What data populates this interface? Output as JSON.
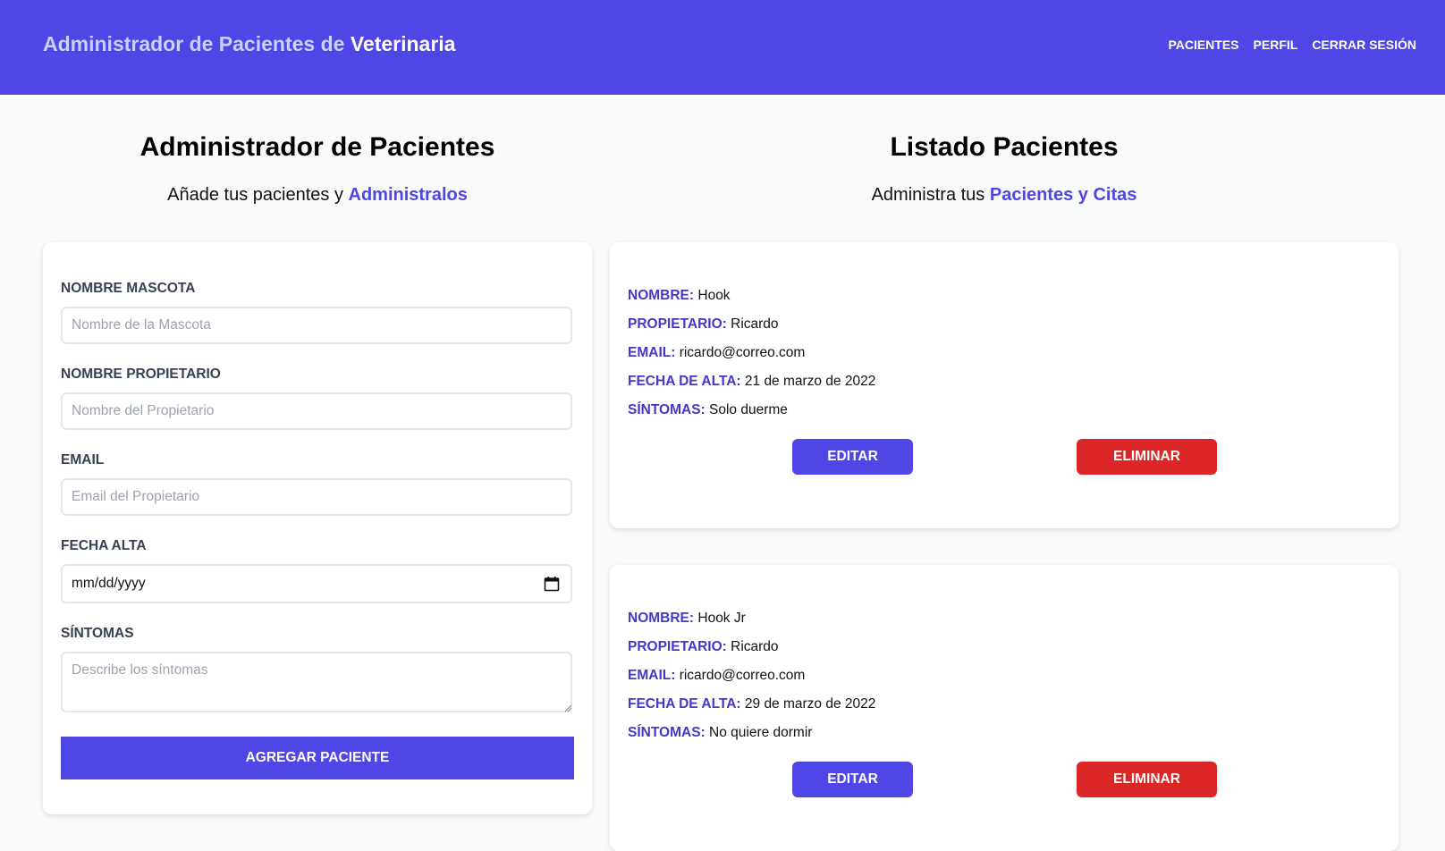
{
  "header": {
    "brand_light": "Administrador de Pacientes de ",
    "brand_strong": "Veterinaria",
    "nav": [
      "Pacientes",
      "Perfil",
      "Cerrar Sesión"
    ]
  },
  "form_section": {
    "title": "Administrador de Pacientes",
    "subtitle_prefix": "Añade tus pacientes y ",
    "subtitle_accent": "Administralos"
  },
  "form": {
    "fields": [
      {
        "label": "Nombre Mascota",
        "placeholder": "Nombre de la Mascota"
      },
      {
        "label": "Nombre Propietario",
        "placeholder": "Nombre del Propietario"
      },
      {
        "label": "Email",
        "placeholder": "Email del Propietario"
      },
      {
        "label": "Fecha Alta",
        "value": "mm/dd/yyyy"
      },
      {
        "label": "Síntomas",
        "placeholder": "Describe los síntomas"
      }
    ],
    "submit_label": "Agregar Paciente"
  },
  "list_section": {
    "title": "Listado Pacientes",
    "subtitle_prefix": "Administra tus ",
    "subtitle_accent": "Pacientes y Citas"
  },
  "field_labels": {
    "nombre": "Nombre:",
    "propietario": "Propietario:",
    "email": "Email:",
    "fecha": "Fecha de Alta:",
    "sintomas": "Síntomas:"
  },
  "patients": [
    {
      "nombre": "Hook",
      "propietario": "Ricardo",
      "email": "ricardo@correo.com",
      "fecha": "21 de marzo de 2022",
      "sintomas": "Solo duerme",
      "edit_label": "Editar",
      "delete_label": "Eliminar"
    },
    {
      "nombre": "Hook Jr",
      "propietario": "Ricardo",
      "email": "ricardo@correo.com",
      "fecha": "29 de marzo de 2022",
      "sintomas": "No quiere dormir",
      "edit_label": "Editar",
      "delete_label": "Eliminar"
    }
  ],
  "colors": {
    "primary": "#4f46e5",
    "danger": "#dc2626",
    "label_accent": "#4338ca"
  }
}
